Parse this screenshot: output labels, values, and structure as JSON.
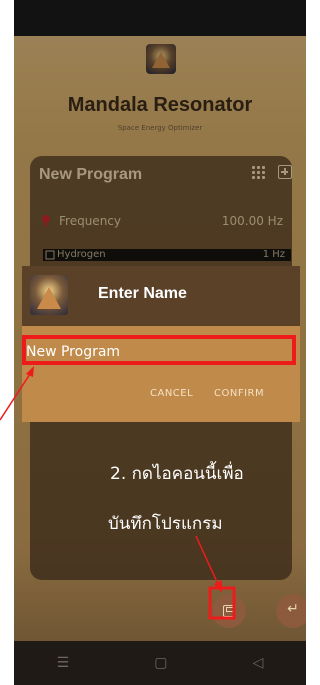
{
  "app": {
    "title": "Mandala Resonator",
    "subtitle": "Space Energy Optimizer"
  },
  "program": {
    "title": "New Program",
    "rows": [
      {
        "label": "Frequency",
        "value": "100.00 Hz",
        "icon": "tree-icon"
      },
      {
        "label": "Hydrogen",
        "value": "1 Hz",
        "icon": "element-icon"
      }
    ]
  },
  "dialog": {
    "title": "Enter Name",
    "input_value": "New Program",
    "cancel_label": "CANCEL",
    "confirm_label": "CONFIRM"
  },
  "annotations": {
    "line1": "2. กดไอคอนนี้เพื่อ",
    "line2": "บันทึกโปรแกรม",
    "highlight_color": "#ee1b1b"
  },
  "navbar": {
    "menu": "☰",
    "home": "▢",
    "back": "◁"
  },
  "colors": {
    "dialog_header": "#5b4128",
    "dialog_body": "#c08a4a",
    "fab": "#8c5a3c"
  }
}
